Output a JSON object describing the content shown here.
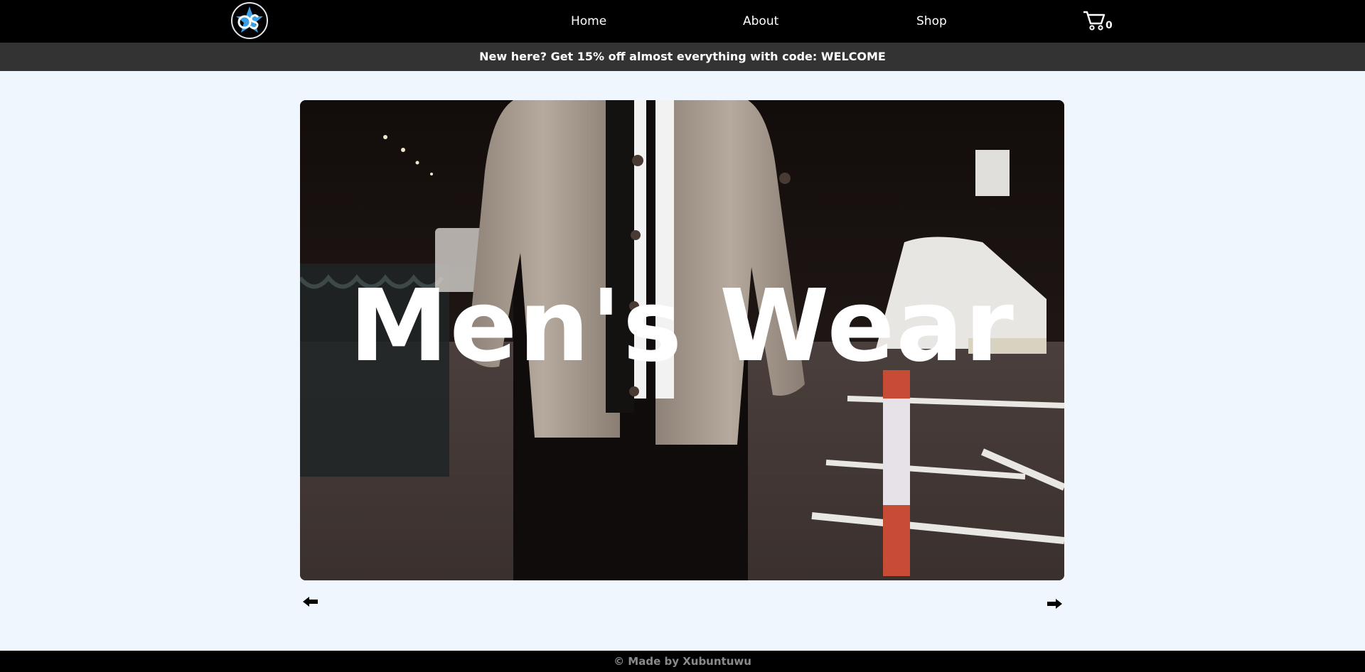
{
  "nav": {
    "logo_icon": "os-star-logo-icon",
    "links": [
      "Home",
      "About",
      "Shop"
    ],
    "cart_icon": "cart-icon",
    "cart_count": "0"
  },
  "promo": {
    "text": "New here? Get 15% off almost everything with code: WELCOME"
  },
  "hero": {
    "title": "Men's Wear",
    "image": "man-in-denim-jacket-street-photo"
  },
  "carousel": {
    "prev_icon": "arrow-left-icon",
    "next_icon": "arrow-right-icon"
  },
  "footer": {
    "text": "© Made by Xubuntuwu"
  },
  "colors": {
    "nav_bg": "#000000",
    "promo_bg": "#333333",
    "page_bg": "#f0f6fd",
    "accent": "#3aa0e8"
  }
}
